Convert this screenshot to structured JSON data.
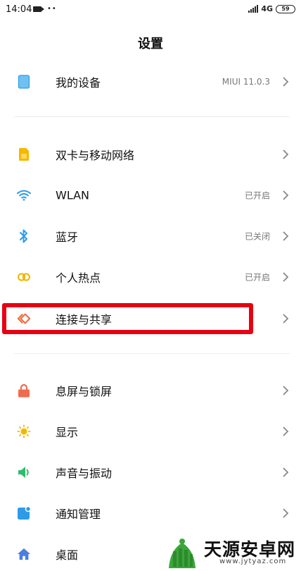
{
  "status_bar": {
    "time": "14:04",
    "network": "4G",
    "battery": "59"
  },
  "page": {
    "title": "设置"
  },
  "device": {
    "label": "我的设备",
    "value": "MIUI 11.0.3"
  },
  "network_items": [
    {
      "label": "双卡与移动网络",
      "value": "",
      "icon": "sim-card-icon",
      "color": "#f5b800"
    },
    {
      "label": "WLAN",
      "value": "已开启",
      "icon": "wifi-icon",
      "color": "#2f9be8"
    },
    {
      "label": "蓝牙",
      "value": "已关闭",
      "icon": "bluetooth-icon",
      "color": "#2f9be8"
    },
    {
      "label": "个人热点",
      "value": "已开启",
      "icon": "hotspot-icon",
      "color": "#f0b400"
    },
    {
      "label": "连接与共享",
      "value": "",
      "icon": "connection-share-icon",
      "color": "#f06a3e"
    }
  ],
  "display_items": [
    {
      "label": "息屏与锁屏",
      "icon": "lock-icon",
      "color": "#f06a50"
    },
    {
      "label": "显示",
      "icon": "sun-icon",
      "color": "#f5b800"
    },
    {
      "label": "声音与振动",
      "icon": "speaker-icon",
      "color": "#2dbd6e"
    },
    {
      "label": "通知管理",
      "icon": "notification-icon",
      "color": "#2f9be8"
    },
    {
      "label": "桌面",
      "icon": "home-icon",
      "color": "#4a7fe0"
    }
  ],
  "watermark": {
    "name": "天源安卓网",
    "url": "www.jytyaz.com"
  }
}
